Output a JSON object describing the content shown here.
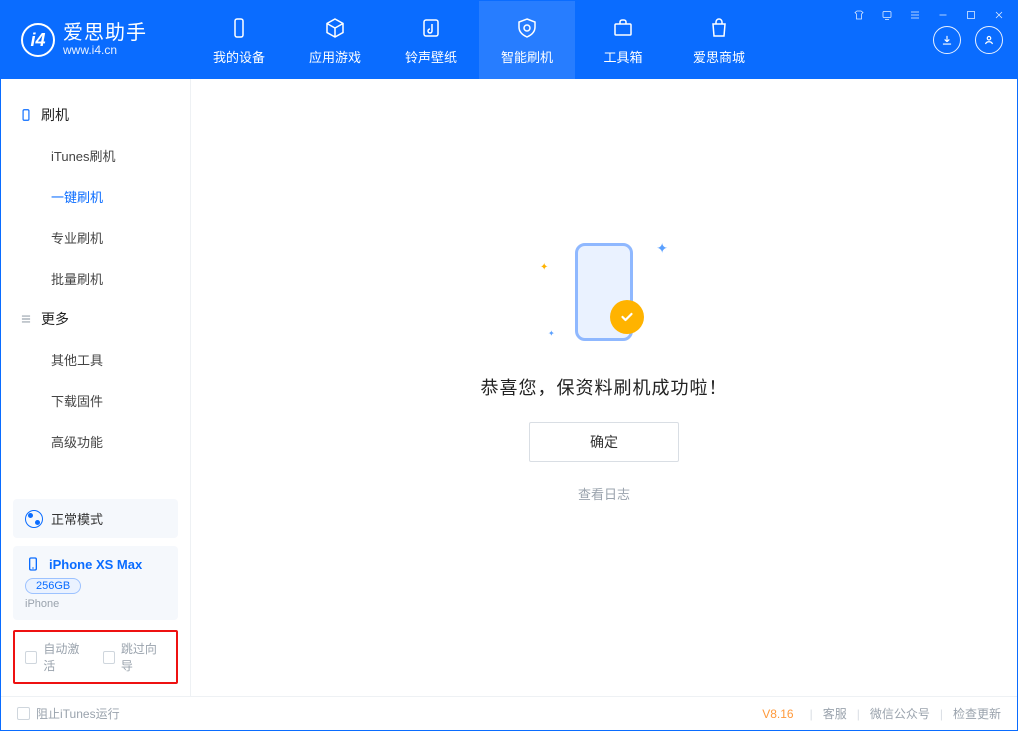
{
  "app": {
    "name": "爱思助手",
    "website": "www.i4.cn"
  },
  "nav": {
    "items": [
      {
        "label": "我的设备"
      },
      {
        "label": "应用游戏"
      },
      {
        "label": "铃声壁纸"
      },
      {
        "label": "智能刷机"
      },
      {
        "label": "工具箱"
      },
      {
        "label": "爱思商城"
      }
    ],
    "active_index": 3
  },
  "sidebar": {
    "groups": [
      {
        "title": "刷机",
        "items": [
          {
            "label": "iTunes刷机"
          },
          {
            "label": "一键刷机"
          },
          {
            "label": "专业刷机"
          },
          {
            "label": "批量刷机"
          }
        ],
        "active_index": 1
      },
      {
        "title": "更多",
        "items": [
          {
            "label": "其他工具"
          },
          {
            "label": "下载固件"
          },
          {
            "label": "高级功能"
          }
        ]
      }
    ],
    "mode_label": "正常模式",
    "device": {
      "name": "iPhone XS Max",
      "storage": "256GB",
      "type": "iPhone"
    },
    "checkboxes": {
      "auto_activate": "自动激活",
      "skip_guide": "跳过向导"
    }
  },
  "main": {
    "success_message": "恭喜您，保资料刷机成功啦！",
    "ok_button": "确定",
    "view_log": "查看日志"
  },
  "footer": {
    "itunes_block": "阻止iTunes运行",
    "version": "V8.16",
    "links": {
      "support": "客服",
      "wechat": "微信公众号",
      "update": "检查更新"
    }
  }
}
